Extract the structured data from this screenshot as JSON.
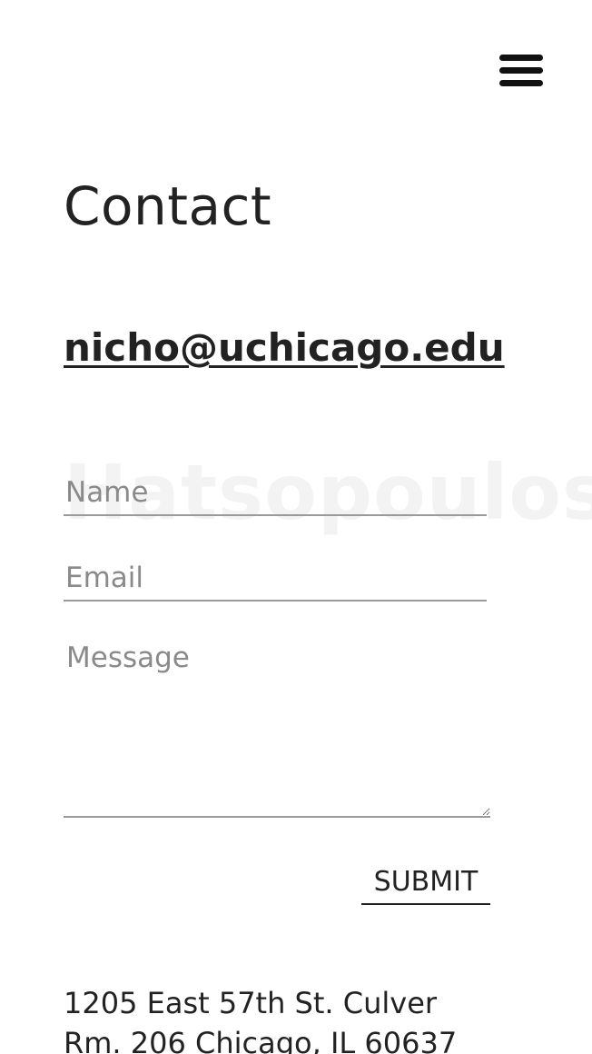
{
  "header": {
    "menu_icon": "hamburger-menu-icon"
  },
  "main": {
    "title": "Contact",
    "email": "nicho@uchicago.edu",
    "watermark": "Hatsopoulos"
  },
  "form": {
    "name_placeholder": "Name",
    "name_value": "",
    "email_placeholder": "Email",
    "email_value": "",
    "message_placeholder": "Message",
    "message_value": "",
    "submit_label": "SUBMIT"
  },
  "footer": {
    "address_line1": "1205 East 57th St. Culver",
    "address_line2": "Rm. 206 Chicago, IL 60637"
  }
}
